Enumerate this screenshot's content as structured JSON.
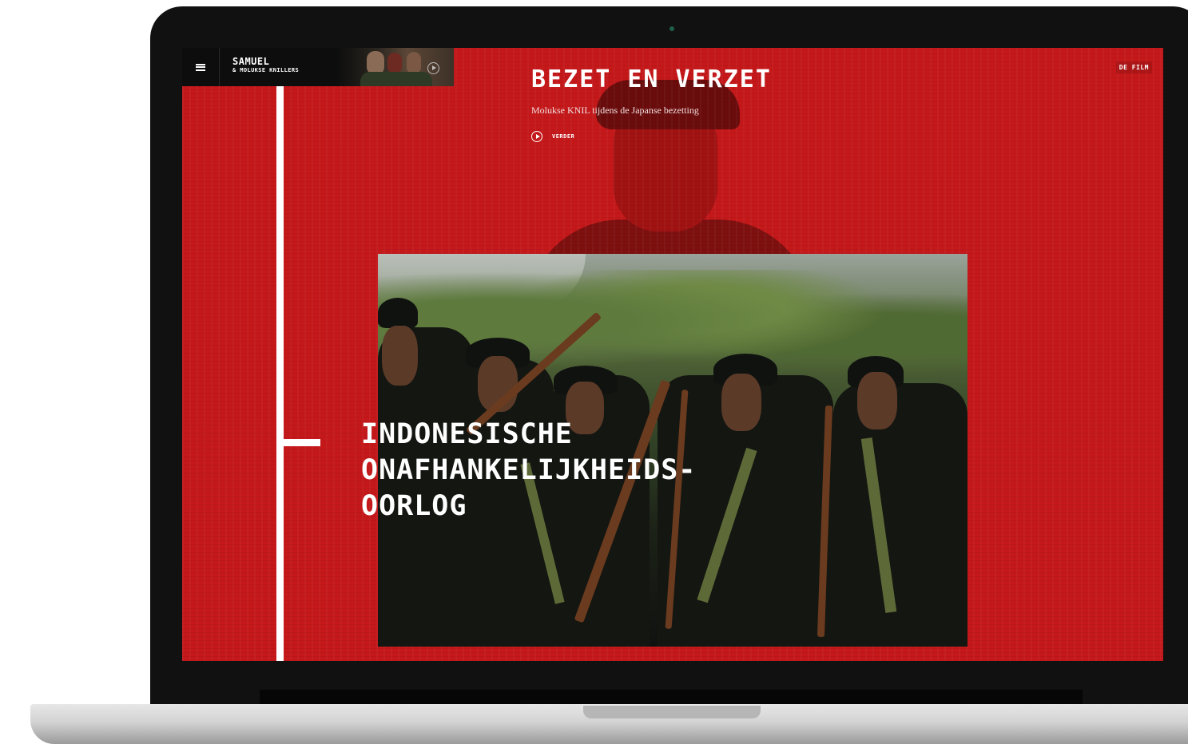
{
  "header": {
    "brand_title": "SAMUEL",
    "brand_subtitle": "& MOLUKSE KNILLERS",
    "film_link": "DE FILM"
  },
  "hero": {
    "title": "BEZET EN VERZET",
    "subtitle": "Molukse KNIL tijdens de Japanse bezetting",
    "play_label": "VERDER"
  },
  "section": {
    "title_lines": [
      "INDONESISCHE",
      "ONAFHANKELIJKHEIDS-",
      "OORLOG"
    ]
  },
  "colors": {
    "accent": "#c4181a",
    "text": "#ffffff",
    "dark": "#0d0d0d"
  }
}
